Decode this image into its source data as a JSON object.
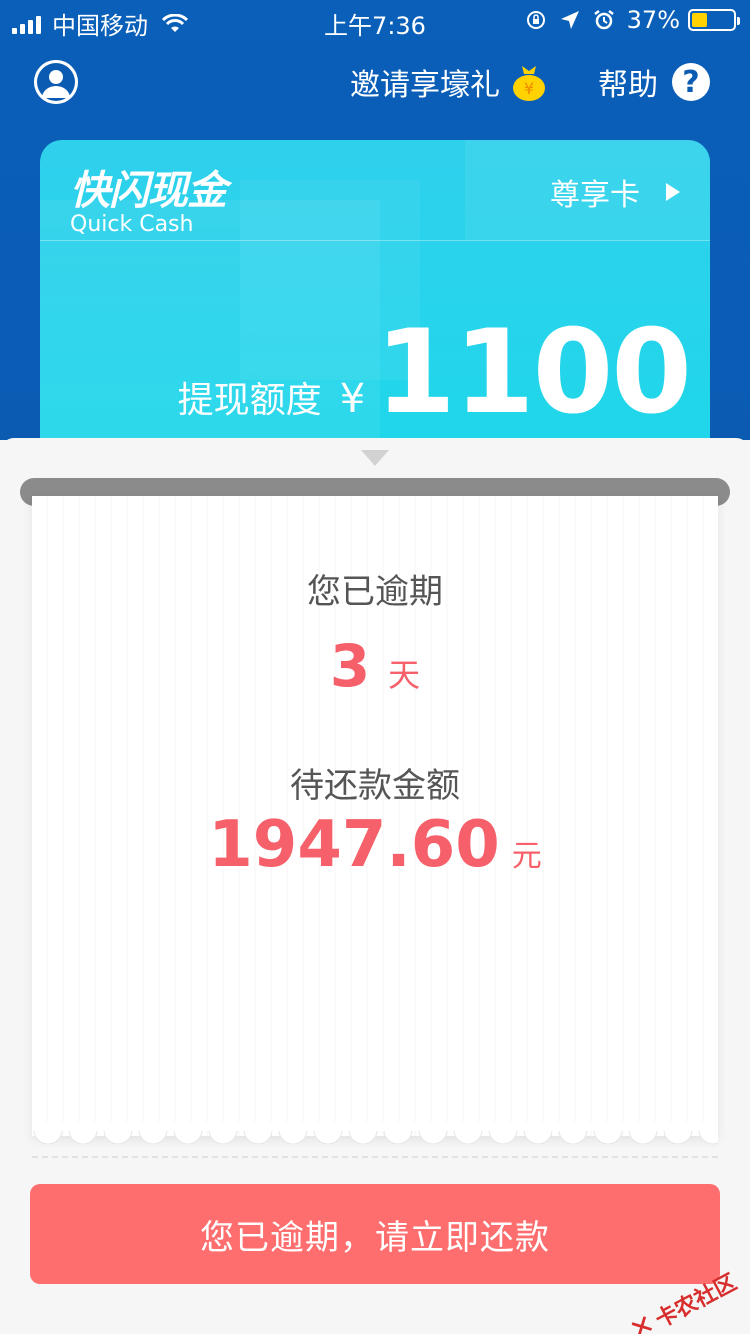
{
  "status_bar": {
    "carrier": "中国移动",
    "time": "上午7:36",
    "battery": "37%",
    "battery_level": 0.37
  },
  "header": {
    "invite_label": "邀请享壕礼",
    "help_label": "帮助",
    "help_glyph": "?"
  },
  "card": {
    "brand_cn": "快闪现金",
    "brand_en": "Quick Cash",
    "vip_label": "尊享卡",
    "limit_label": "提现额度",
    "currency": "¥",
    "limit_value": "1100"
  },
  "bill": {
    "overdue_label": "您已逾期",
    "overdue_days": "3",
    "overdue_unit": "天",
    "amount_label": "待还款金额",
    "amount_value": "1947.60",
    "amount_unit": "元"
  },
  "actions": {
    "pay_label": "您已逾期，请立即还款"
  },
  "watermark": {
    "text": "卡农社区"
  },
  "colors": {
    "brand_blue": "#0b5bb3",
    "card_cyan": "#1fd7ea",
    "alert_red": "#f5606a",
    "button_red": "#ff6e6e"
  }
}
